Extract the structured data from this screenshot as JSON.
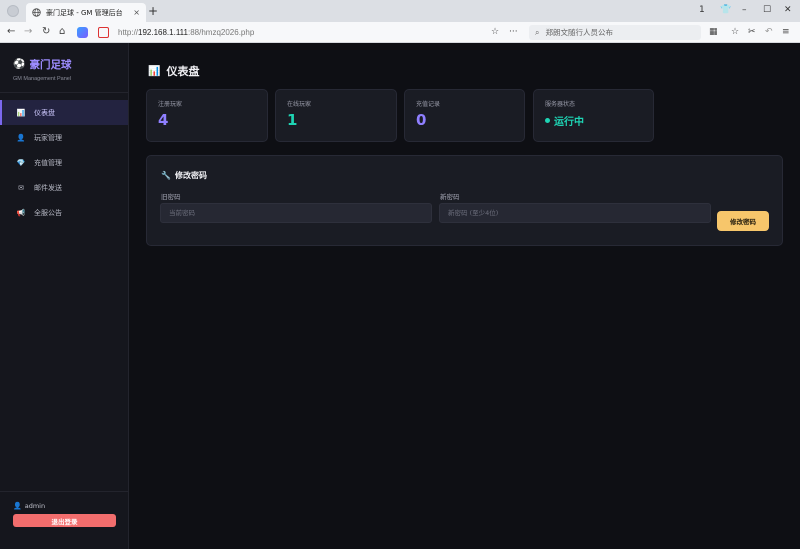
{
  "browser": {
    "tab_title": "豪门足球 - GM 管理后台",
    "tab_close": "×",
    "new_tab": "+",
    "url_prefix": "http://",
    "url_host": "192.168.1.111",
    "url_rest": ":88/hmzq2026.php",
    "search_text": "郑朗文随行人员公布",
    "window_controls": {
      "reader": "1",
      "minimize": "–",
      "maximize": "☐",
      "close": "✕"
    },
    "nav_icons": {
      "back": "←",
      "forward": "→",
      "reload": "↻",
      "home": "⌂"
    },
    "url_icons": {
      "star": "☆",
      "more": "···"
    },
    "toolbar_icons": {
      "grid": "▦",
      "bookmark": "☆",
      "scissors": "✂",
      "undo": "↶",
      "menu": "≡"
    }
  },
  "app": {
    "brand_icon": "⚽",
    "brand_title": "豪门足球",
    "brand_subtitle": "GM Management Panel",
    "accent_color": "#7b68ee"
  },
  "sidebar": {
    "items": [
      {
        "icon": "📊",
        "icon_name": "chart-icon",
        "label": "仪表盘",
        "active": true
      },
      {
        "icon": "👤",
        "icon_name": "user-icon",
        "label": "玩家管理",
        "active": false
      },
      {
        "icon": "💎",
        "icon_name": "gem-icon",
        "label": "充值管理",
        "active": false
      },
      {
        "icon": "✉",
        "icon_name": "mail-icon",
        "label": "邮件发送",
        "active": false
      },
      {
        "icon": "📢",
        "icon_name": "megaphone-icon",
        "label": "全服公告",
        "active": false
      }
    ],
    "user_icon": "👤",
    "username": "admin",
    "logout_label": "退出登录"
  },
  "dashboard": {
    "title_icon": "📊",
    "title": "仪表盘",
    "stats": [
      {
        "label": "注册玩家",
        "value": "4",
        "color": "#8f7fff"
      },
      {
        "label": "在线玩家",
        "value": "1",
        "color": "#1ed4b4"
      },
      {
        "label": "充值记录",
        "value": "0",
        "color": "#8f7fff"
      },
      {
        "label": "服务器状态",
        "value": "运行中",
        "color": "#1ed4b4"
      }
    ]
  },
  "password_panel": {
    "title_icon": "🔧",
    "title": "修改密码",
    "old_label": "旧密码",
    "old_placeholder": "当前密码",
    "new_label": "新密码",
    "new_placeholder": "新密码 (至少4位)",
    "submit_label": "修改密码"
  }
}
